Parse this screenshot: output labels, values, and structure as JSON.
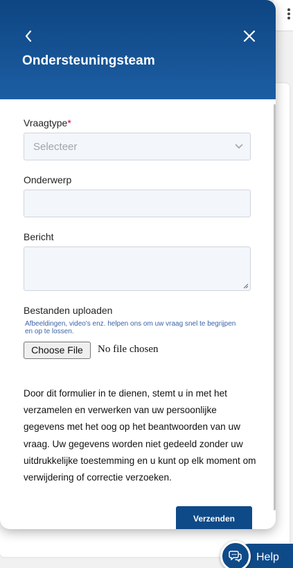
{
  "dialog": {
    "title": "Ondersteuningsteam",
    "back_icon": "chevron-left-icon",
    "close_icon": "close-icon"
  },
  "form": {
    "question_type": {
      "label": "Vraagtype",
      "required_mark": "*",
      "selected": "Selecteer"
    },
    "subject": {
      "label": "Onderwerp",
      "value": ""
    },
    "message": {
      "label": "Bericht",
      "value": ""
    },
    "upload": {
      "label": "Bestanden uploaden",
      "hint": "Afbeeldingen, video's enz. helpen ons om uw vraag snel te begrijpen en op te lossen.",
      "button": "Choose File",
      "status": "No file chosen"
    },
    "consent": "Door dit formulier in te dienen, stemt u in met het verzamelen en verwerken van uw persoonlijke gegevens met het oog op het beantwoorden van uw vraag. Uw gegevens worden niet gedeeld zonder uw uitdrukkelijke toestemming en u kunt op elk moment om verwijdering of correctie verzoeken.",
    "submit": "Verzenden"
  },
  "help_launcher": {
    "label": "Help",
    "icon": "chat-bubbles-icon"
  },
  "colors": {
    "header_dark": "#0e4582",
    "header_light": "#1c5ea3",
    "primary": "#0f4a88",
    "required": "#d0021b",
    "hint": "#3b63a8"
  }
}
